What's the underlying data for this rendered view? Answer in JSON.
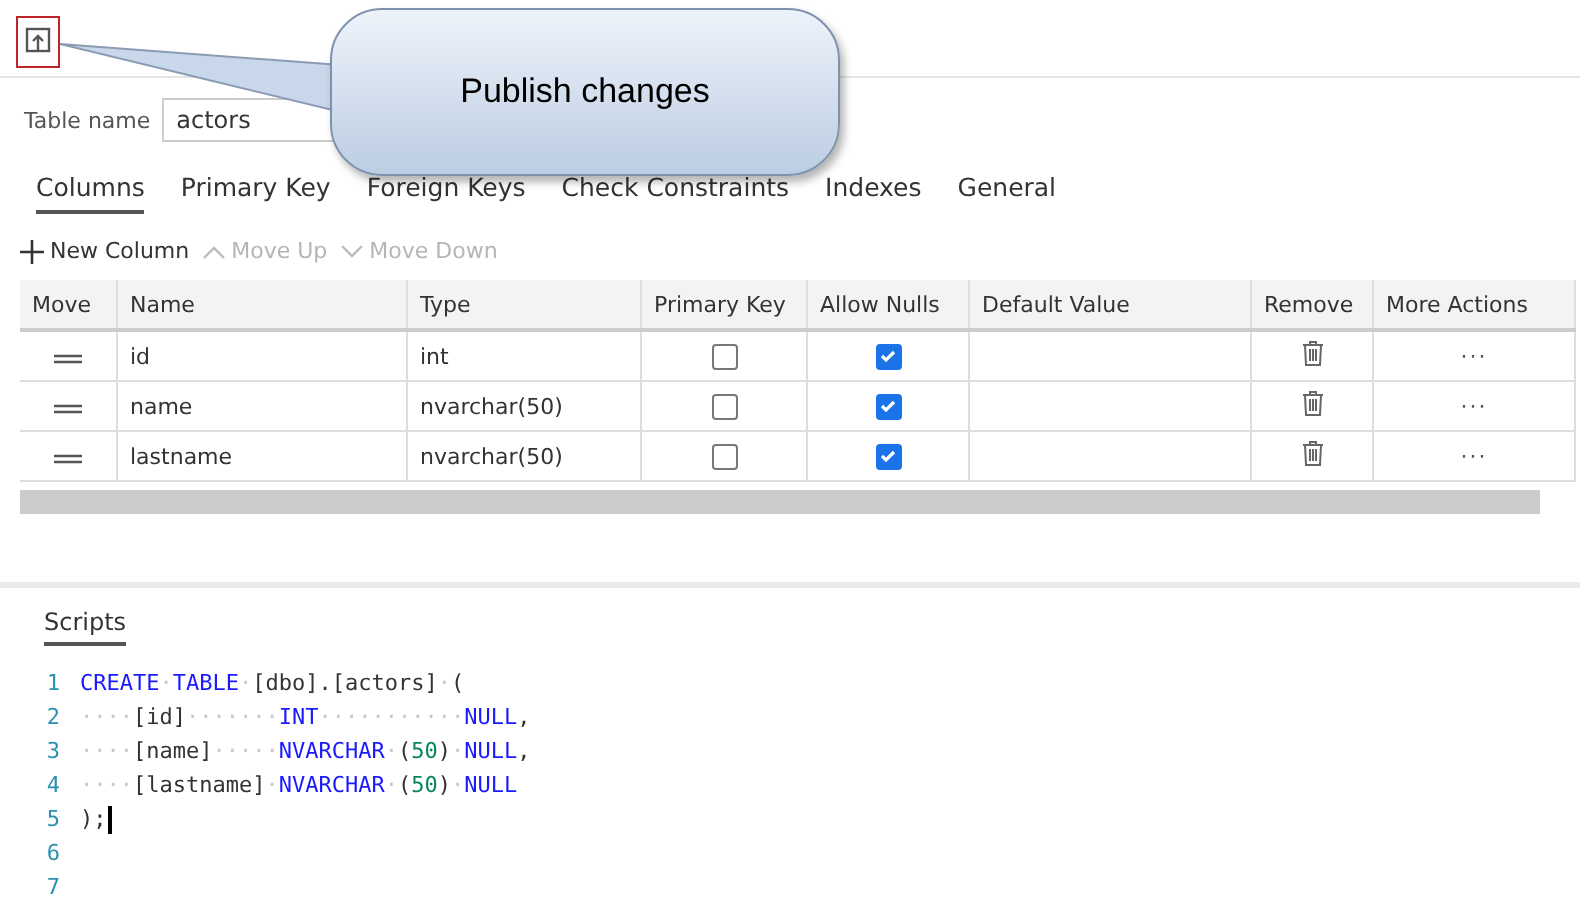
{
  "callout": {
    "text": "Publish changes"
  },
  "table_name": {
    "label": "Table name",
    "value": "actors"
  },
  "tabs": [
    {
      "label": "Columns",
      "selected": true
    },
    {
      "label": "Primary Key",
      "selected": false
    },
    {
      "label": "Foreign Keys",
      "selected": false
    },
    {
      "label": "Check Constraints",
      "selected": false
    },
    {
      "label": "Indexes",
      "selected": false
    },
    {
      "label": "General",
      "selected": false
    }
  ],
  "toolbar": [
    {
      "label": "New Column",
      "kind": "add",
      "disabled": false
    },
    {
      "label": "Move Up",
      "kind": "up",
      "disabled": true
    },
    {
      "label": "Move Down",
      "kind": "down",
      "disabled": true
    }
  ],
  "table": {
    "columns": [
      "Move",
      "Name",
      "Type",
      "Primary Key",
      "Allow Nulls",
      "Default Value",
      "Remove",
      "More Actions"
    ],
    "rows": [
      {
        "name": "id",
        "type": "int",
        "primary_key": false,
        "allow_nulls": true,
        "more": "···"
      },
      {
        "name": "name",
        "type": "nvarchar(50)",
        "primary_key": false,
        "allow_nulls": true,
        "more": "···"
      },
      {
        "name": "lastname",
        "type": "nvarchar(50)",
        "primary_key": false,
        "allow_nulls": true,
        "more": "···"
      }
    ]
  },
  "scripts": {
    "tab": "Scripts",
    "lines": [
      {
        "number": "1",
        "tokens": [
          {
            "t": "CREATE",
            "kind": "kw"
          },
          {
            "t": "·",
            "kind": "ws"
          },
          {
            "t": "TABLE",
            "kind": "kw"
          },
          {
            "t": "·",
            "kind": "ws"
          },
          {
            "t": "[dbo].[actors]",
            "kind": "id"
          },
          {
            "t": "·",
            "kind": "ws"
          },
          {
            "t": "(",
            "kind": "id"
          }
        ]
      },
      {
        "number": "2",
        "tokens": [
          {
            "t": "····",
            "kind": "ws"
          },
          {
            "t": "[id]",
            "kind": "id"
          },
          {
            "t": "·······",
            "kind": "ws"
          },
          {
            "t": "INT",
            "kind": "kw"
          },
          {
            "t": "···········",
            "kind": "ws"
          },
          {
            "t": "NULL",
            "kind": "kw"
          },
          {
            "t": ",",
            "kind": "id"
          }
        ]
      },
      {
        "number": "3",
        "tokens": [
          {
            "t": "····",
            "kind": "ws"
          },
          {
            "t": "[name]",
            "kind": "id"
          },
          {
            "t": "·····",
            "kind": "ws"
          },
          {
            "t": "NVARCHAR",
            "kind": "kw"
          },
          {
            "t": "·",
            "kind": "ws"
          },
          {
            "t": "(",
            "kind": "id"
          },
          {
            "t": "50",
            "kind": "num"
          },
          {
            "t": ")",
            "kind": "id"
          },
          {
            "t": "·",
            "kind": "ws"
          },
          {
            "t": "NULL",
            "kind": "kw"
          },
          {
            "t": ",",
            "kind": "id"
          }
        ]
      },
      {
        "number": "4",
        "tokens": [
          {
            "t": "····",
            "kind": "ws"
          },
          {
            "t": "[lastname]",
            "kind": "id"
          },
          {
            "t": "·",
            "kind": "ws"
          },
          {
            "t": "NVARCHAR",
            "kind": "kw"
          },
          {
            "t": "·",
            "kind": "ws"
          },
          {
            "t": "(",
            "kind": "id"
          },
          {
            "t": "50",
            "kind": "num"
          },
          {
            "t": ")",
            "kind": "id"
          },
          {
            "t": "·",
            "kind": "ws"
          },
          {
            "t": "NULL",
            "kind": "kw"
          }
        ]
      },
      {
        "number": "5",
        "tokens": [
          {
            "t": ");",
            "kind": "id"
          }
        ],
        "cursor": true
      },
      {
        "number": "6"
      },
      {
        "number": "7"
      }
    ]
  }
}
